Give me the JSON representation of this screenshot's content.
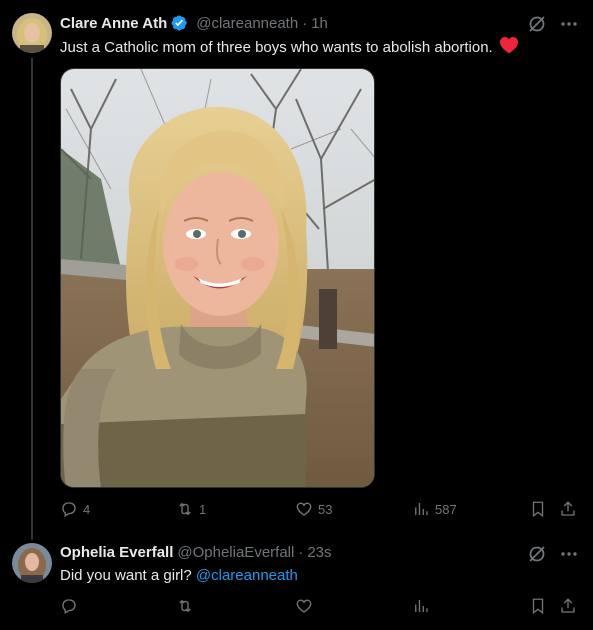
{
  "post1": {
    "author_name": "Clare Anne Ath",
    "handle": "@clareanneath",
    "separator": "·",
    "time": "1h",
    "text": "Just a Catholic mom of three boys who wants to abolish abortion.",
    "heart_emoji": "red-heart-emoji",
    "photo_alt": "photo",
    "actions": {
      "replies": "4",
      "reposts": "1",
      "likes": "53",
      "views": "587"
    }
  },
  "post2": {
    "author_name": "Ophelia Everfall",
    "handle": "@OpheliaEverfall",
    "separator": "·",
    "time": "23s",
    "text": "Did you want a girl? ",
    "mention": "@clareanneath",
    "actions": {
      "replies": "",
      "reposts": "",
      "likes": "",
      "views": ""
    }
  },
  "colors": {
    "background": "#000000",
    "text": "#e7e9ea",
    "muted": "#71767b",
    "accent": "#1d9bf0",
    "heart": "#f91880"
  },
  "icons": [
    "verified-badge-icon",
    "grok-icon",
    "more-icon",
    "reply-icon",
    "repost-icon",
    "like-icon",
    "views-icon",
    "bookmark-icon",
    "share-icon"
  ]
}
